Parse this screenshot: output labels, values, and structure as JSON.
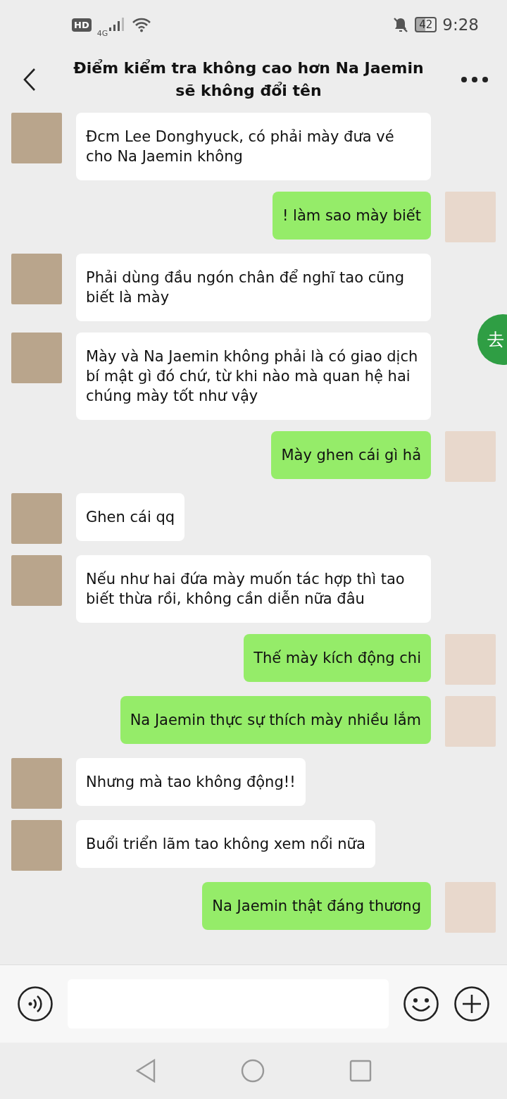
{
  "status_bar": {
    "hd": "HD",
    "network": "4G",
    "battery": "42",
    "time": "9:28"
  },
  "header": {
    "title": "Điểm kiểm tra không cao hơn Na Jaemin sẽ không đổi tên"
  },
  "messages": [
    {
      "kind": "incoming",
      "text": "Đcm Lee Donghyuck, có phải mày đưa vé cho Na Jaemin không"
    },
    {
      "kind": "outgoing",
      "text": "! làm sao mày biết"
    },
    {
      "kind": "incoming",
      "text": "Phải dùng đầu ngón chân để nghĩ tao cũng biết là mày"
    },
    {
      "kind": "incoming",
      "text": "Mày và Na Jaemin không phải là có giao dịch bí mật gì đó chứ, từ khi nào mà quan hệ hai chúng mày tốt như vậy"
    },
    {
      "kind": "outgoing",
      "text": "Mày ghen cái gì hả"
    },
    {
      "kind": "incoming",
      "text": "Ghen cái qq"
    },
    {
      "kind": "incoming",
      "text": "Nếu như hai đứa mày muốn tác hợp thì tao biết thừa rồi, không cần diễn nữa đâu"
    },
    {
      "kind": "outgoing",
      "text": "Thế mày kích động chi"
    },
    {
      "kind": "outgoing",
      "text": "Na Jaemin thực sự thích mày nhiều lắm"
    },
    {
      "kind": "incoming",
      "text": "Nhưng mà tao không động!!"
    },
    {
      "kind": "incoming",
      "text": "Buổi triển lãm tao không xem nổi nữa"
    },
    {
      "kind": "outgoing",
      "text": "Na Jaemin thật đáng thương"
    }
  ],
  "floating_button": {
    "text": "去"
  }
}
